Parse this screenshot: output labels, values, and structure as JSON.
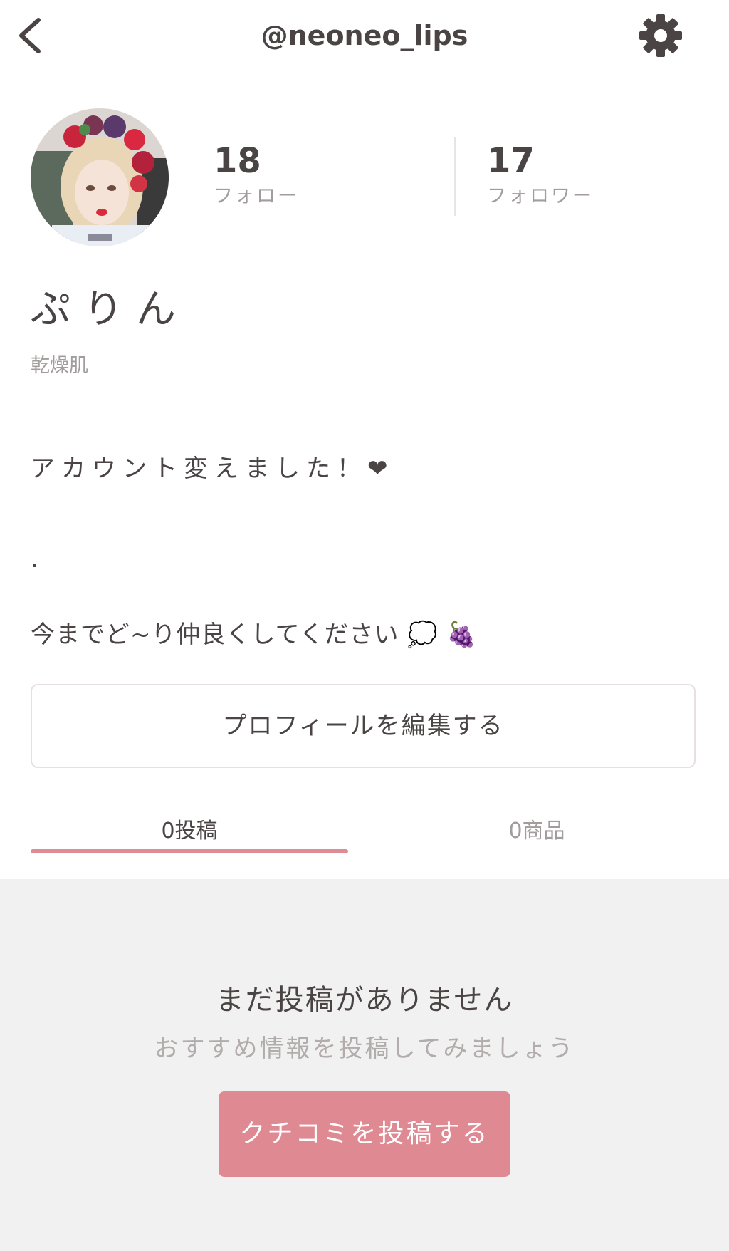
{
  "header": {
    "handle": "@neoneo_lips",
    "back_icon": "chevron-left-icon",
    "settings_icon": "gear-icon"
  },
  "profile": {
    "avatar_icon": "avatar",
    "following": {
      "count": "18",
      "label": "フォロー"
    },
    "followers": {
      "count": "17",
      "label": "フォロワー"
    },
    "display_name": "ぷりん",
    "skin_type": "乾燥肌",
    "bio": {
      "line1": "アカウント変えました！❤",
      "line2": ".",
      "line3": "今までど~り仲良くしてください 💭 🍇"
    },
    "edit_button": "プロフィールを編集する"
  },
  "tabs": [
    {
      "label": "0投稿",
      "active": true
    },
    {
      "label": "0商品",
      "active": false
    }
  ],
  "empty_state": {
    "title": "まだ投稿がありません",
    "subtitle": "おすすめ情報を投稿してみましょう",
    "cta": "クチコミを投稿する"
  },
  "colors": {
    "accent": "#de8b93",
    "text": "#4a4444",
    "muted": "#a29c9c",
    "empty_bg": "#f2f1f1"
  }
}
